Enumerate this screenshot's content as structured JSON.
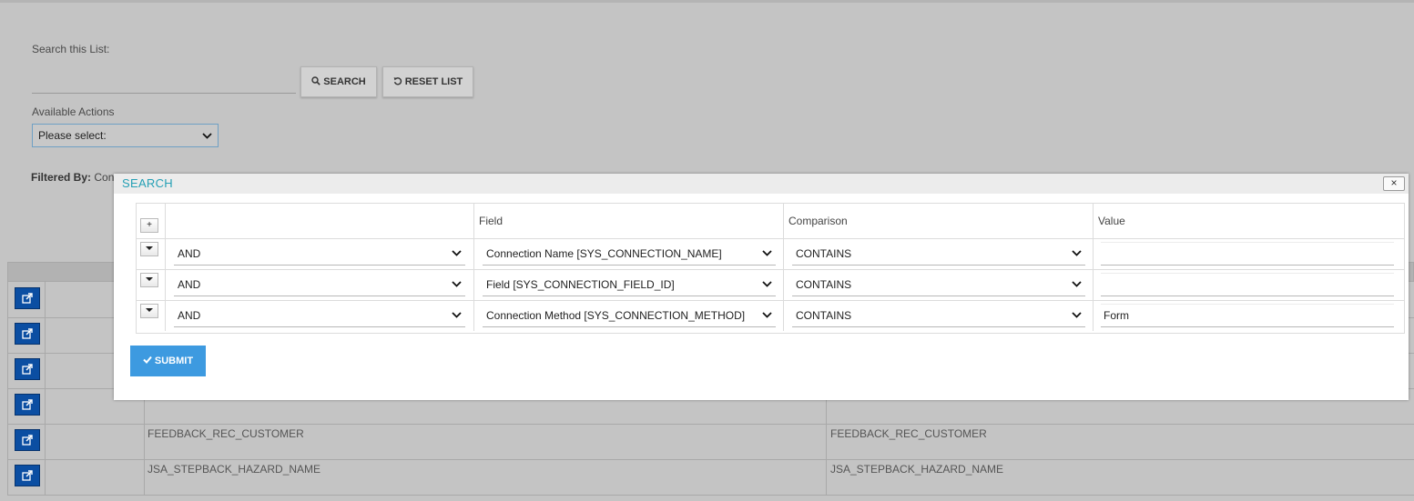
{
  "page": {
    "search_label": "Search this List:",
    "search_placeholder": "",
    "search_button": "SEARCH",
    "reset_button": "RESET LIST",
    "actions_label": "Available Actions",
    "actions_selected": "Please select:",
    "filtered_by_label": "Filtered By:",
    "filtered_by_value": "Con"
  },
  "background_rows": [
    {
      "col3": "",
      "col4": ""
    },
    {
      "col3": "",
      "col4": ""
    },
    {
      "col3": "",
      "col4": ""
    },
    {
      "col3": "",
      "col4": ""
    },
    {
      "col3": "FEEDBACK_REC_CUSTOMER",
      "col4": "FEEDBACK_REC_CUSTOMER"
    },
    {
      "col3": "JSA_STEPBACK_HAZARD_NAME",
      "col4": "JSA_STEPBACK_HAZARD_NAME"
    }
  ],
  "modal": {
    "title": "SEARCH",
    "close_glyph": "×",
    "columns": {
      "field": "Field",
      "comparison": "Comparison",
      "value": "Value"
    },
    "add_glyph": "+",
    "rows": [
      {
        "logic": "AND",
        "field": "Connection Name [SYS_CONNECTION_NAME]",
        "comparison": "CONTAINS",
        "value": ""
      },
      {
        "logic": "AND",
        "field": "Field [SYS_CONNECTION_FIELD_ID]",
        "comparison": "CONTAINS",
        "value": ""
      },
      {
        "logic": "AND",
        "field": "Connection Method [SYS_CONNECTION_METHOD]",
        "comparison": "CONTAINS",
        "value": "Form"
      }
    ],
    "submit_label": "SUBMIT"
  },
  "icons": {
    "search": "magnifier-icon",
    "reset": "refresh-icon",
    "submit": "check-icon",
    "external": "external-link-icon",
    "dropdown": "chevron-down-icon"
  },
  "colors": {
    "modal_title": "#25a0b5",
    "submit_bg": "#3d9ae0",
    "row_button_bg": "#0b4ea2",
    "overlay": "#c4c4c4"
  }
}
